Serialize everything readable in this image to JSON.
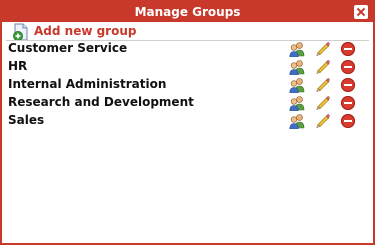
{
  "dialog": {
    "title": "Manage Groups",
    "accent_color": "#c8392b"
  },
  "toolbar": {
    "add_label": "Add new group",
    "add_icon": "add-document-icon"
  },
  "groups": [
    {
      "name": "Customer Service"
    },
    {
      "name": "HR"
    },
    {
      "name": "Internal Administration"
    },
    {
      "name": "Research and Development"
    },
    {
      "name": "Sales"
    }
  ],
  "row_actions": {
    "users_icon": "users-icon",
    "edit_icon": "pencil-icon",
    "delete_icon": "delete-icon"
  }
}
